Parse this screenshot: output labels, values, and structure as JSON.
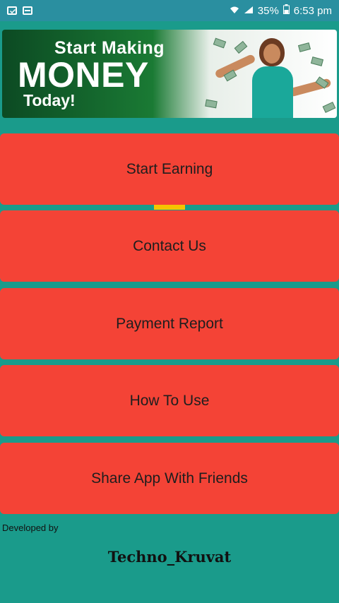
{
  "status_bar": {
    "battery": "35%",
    "time": "6:53 pm",
    "icons": [
      "mail-icon",
      "calendar-icon",
      "wifi-icon",
      "signal-icon",
      "battery-icon"
    ]
  },
  "banner": {
    "line1": "Start Making",
    "line2": "MONEY",
    "line3": "Today!"
  },
  "menu": {
    "items": [
      {
        "label": "Start Earning"
      },
      {
        "label": "Contact Us"
      },
      {
        "label": "Payment Report"
      },
      {
        "label": "How To Use"
      },
      {
        "label": "Share App With Friends"
      }
    ]
  },
  "footer": {
    "developed_by": "Developed by",
    "developer": "Techno_Kruvat"
  },
  "colors": {
    "background": "#1a9b8b",
    "button": "#f44336",
    "status_bar": "#2a8fa0",
    "accent": "#f6c400"
  }
}
